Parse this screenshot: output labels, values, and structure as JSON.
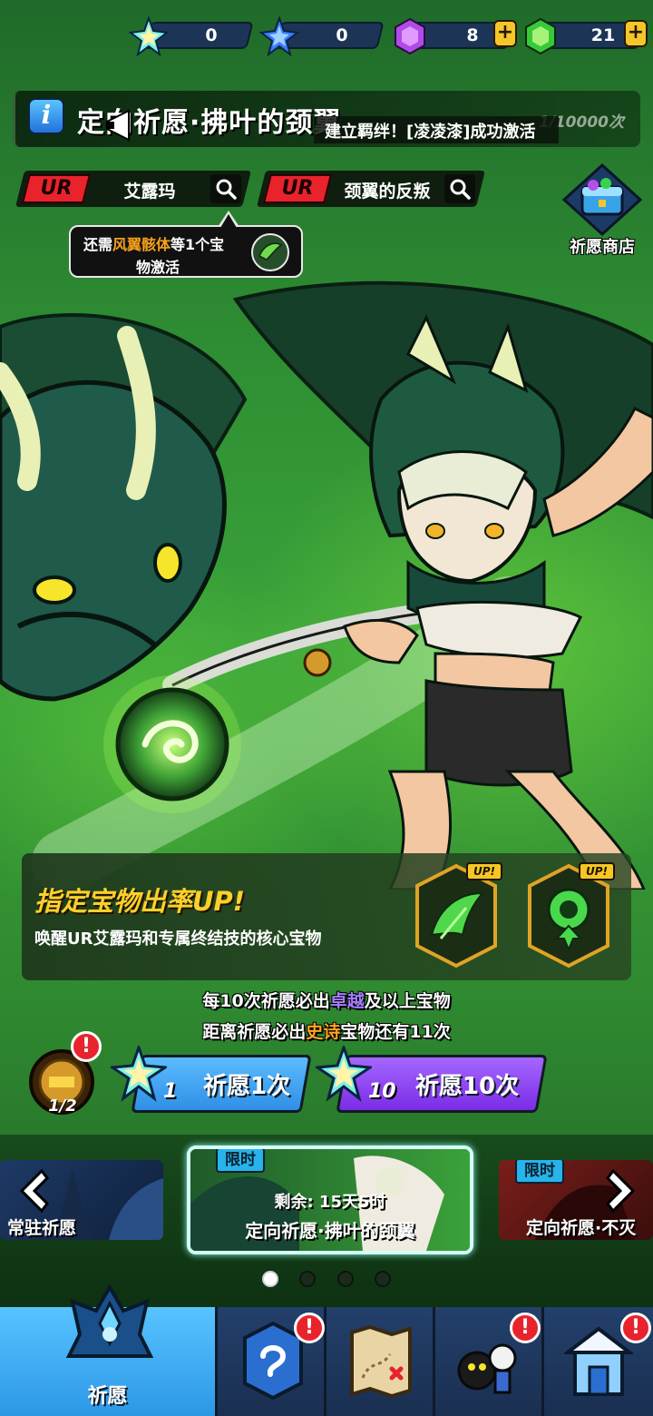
{
  "currency": [
    {
      "name": "star-ticket-rainbow",
      "value": "0",
      "has_plus": false
    },
    {
      "name": "star-ticket-blue",
      "value": "0",
      "has_plus": false
    },
    {
      "name": "purple-gem",
      "value": "8",
      "has_plus": true
    },
    {
      "name": "green-gem",
      "value": "21",
      "has_plus": true
    }
  ],
  "banner": {
    "title": "定向祈愿·拂叶的颈翼",
    "count_text": "1/10000次",
    "marquee": "建立羁绊！[凌凌漆]成功激活"
  },
  "selectors": [
    {
      "tag": "UR",
      "name": "艾露玛"
    },
    {
      "tag": "UR",
      "name": "颈翼的反叛"
    }
  ],
  "tooltip": {
    "prefix": "还需",
    "highlight": "风翼骸体",
    "suffix": "等1个宝",
    "line2": "物激活"
  },
  "shop": {
    "label": "祈愿商店"
  },
  "rateup": {
    "headline": "指定宝物出率UP!",
    "subline": "唤醒UR艾露玛和专属终结技的核心宝物",
    "badge": "UP!"
  },
  "pity": {
    "line1_a": "每10次祈愿必出",
    "line1_hl": "卓越",
    "line1_b": "及以上宝物",
    "line2_a": "距离祈愿必出",
    "line2_hl": "史诗",
    "line2_b": "宝物还有11次"
  },
  "counter": {
    "value": "1/2",
    "alert": "!"
  },
  "wish_buttons": [
    {
      "count": "1",
      "label": "祈愿1次"
    },
    {
      "count": "10",
      "label": "祈愿10次"
    }
  ],
  "carousel": {
    "left_name": "常驻祈愿",
    "center_tag": "限时",
    "center_remaining": "剩余: 15天5时",
    "center_name": "定向祈愿·拂叶的颈翼",
    "right_tag": "限时",
    "right_name": "定向祈愿·不灭的"
  },
  "nav": {
    "active_label": "祈愿",
    "alert": "!"
  },
  "colors": {
    "accent_yellow": "#fbd02b",
    "ur_red": "#e8232c",
    "wish1_blue": "#2f8fe6",
    "wish10_purple": "#8a3df0",
    "nav_active": "#2c98e6"
  }
}
